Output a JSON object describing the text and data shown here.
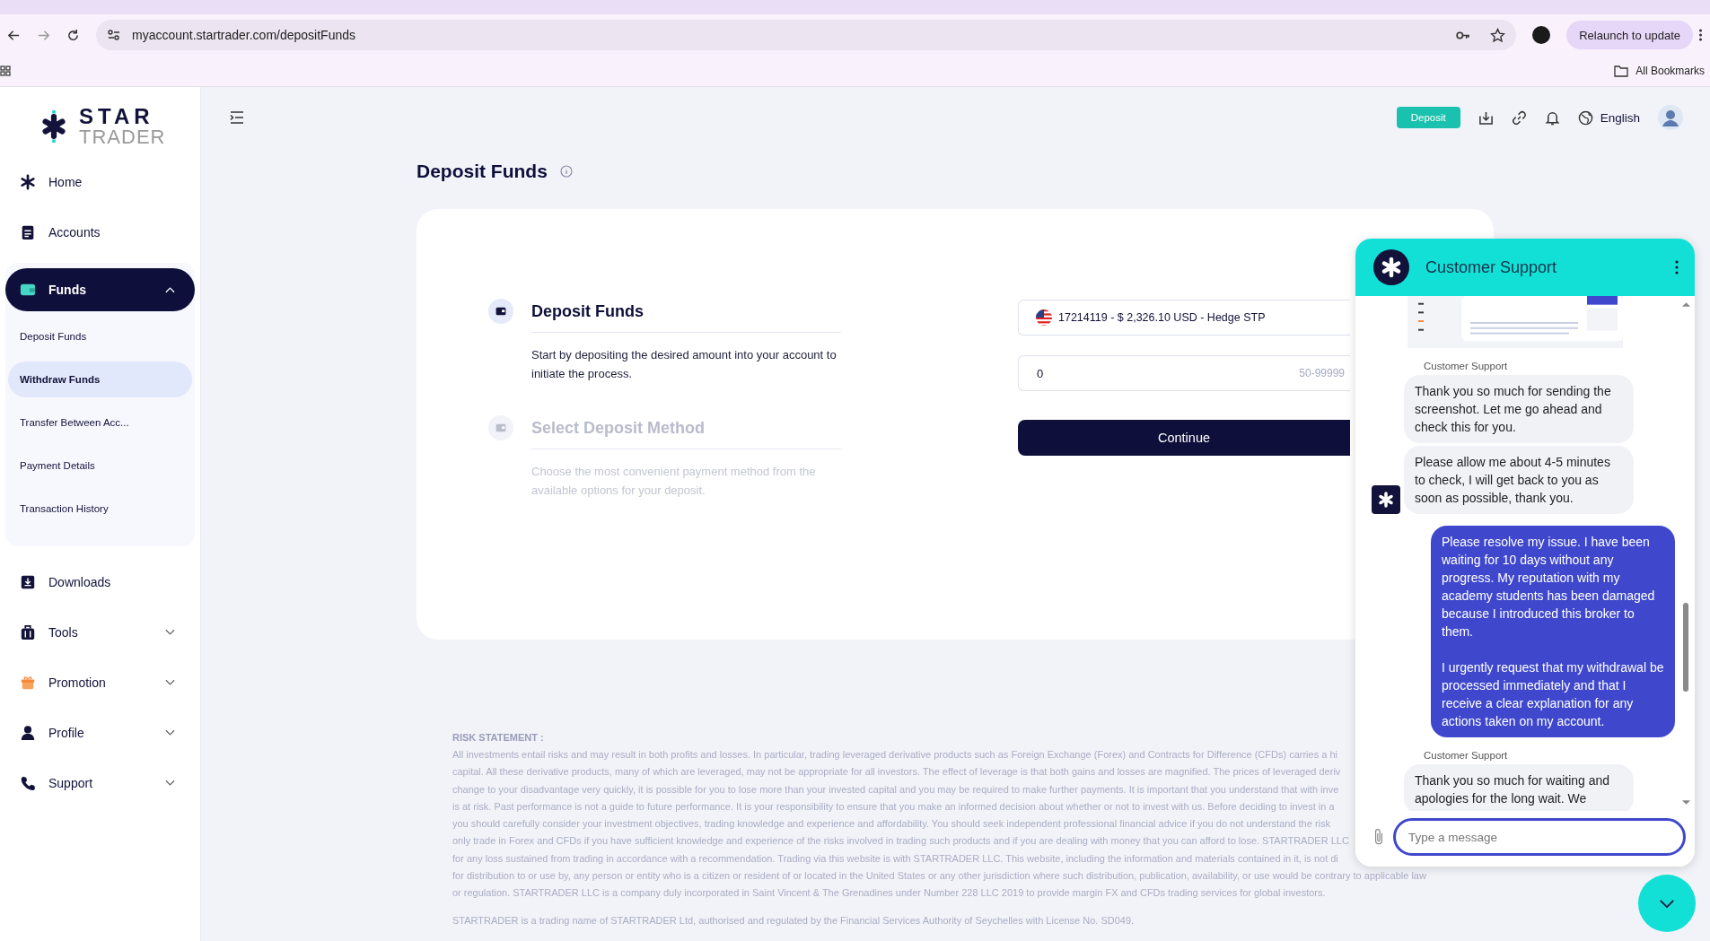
{
  "browser": {
    "url": "myaccount.startrader.com/depositFunds",
    "relaunch": "Relaunch to update",
    "bookmarks": "All Bookmarks"
  },
  "brand": {
    "line1": "STAR",
    "line2": "TRADER"
  },
  "sidebar": {
    "items": [
      {
        "label": "Home",
        "kind": "link",
        "selected": false
      },
      {
        "label": "Accounts",
        "kind": "link",
        "selected": false
      },
      {
        "label": "Funds",
        "kind": "group",
        "selected": true,
        "expanded": true,
        "children": [
          {
            "label": "Deposit Funds",
            "selected": false
          },
          {
            "label": "Withdraw Funds",
            "selected": true
          },
          {
            "label": "Transfer Between Acc...",
            "selected": false
          },
          {
            "label": "Payment Details",
            "selected": false
          },
          {
            "label": "Transaction History",
            "selected": false
          }
        ]
      },
      {
        "label": "Downloads",
        "kind": "link",
        "selected": false
      },
      {
        "label": "Tools",
        "kind": "group",
        "selected": false,
        "expanded": false
      },
      {
        "label": "Promotion",
        "kind": "group",
        "selected": false,
        "expanded": false
      },
      {
        "label": "Profile",
        "kind": "group",
        "selected": false,
        "expanded": false
      },
      {
        "label": "Support",
        "kind": "group",
        "selected": false,
        "expanded": false
      }
    ]
  },
  "header": {
    "deposit_button": "Deposit",
    "language": "English"
  },
  "page": {
    "title": "Deposit Funds"
  },
  "steps": [
    {
      "title": "Deposit Funds",
      "description": "Start by depositing the desired amount into your account to initiate the process.",
      "active": true
    },
    {
      "title": "Select Deposit Method",
      "description": "Choose the most convenient payment method from the available options for your deposit.",
      "active": false
    }
  ],
  "form": {
    "account": "17214119 - $ 2,326.10 USD - Hedge STP",
    "amount": "0",
    "range_hint": "50-99999",
    "button": "Continue"
  },
  "chat": {
    "title": "Customer Support",
    "placeholder": "Type a message",
    "messages": [
      {
        "kind": "picture"
      },
      {
        "kind": "sender",
        "text": "Customer Support"
      },
      {
        "kind": "agent",
        "text": "Thank you so much for sending the screenshot. Let me go ahead and check this for you.",
        "avatar": false
      },
      {
        "kind": "agent",
        "text": "Please allow me about 4-5 minutes to check, I will get back to you as soon as possible, thank you.",
        "avatar": true
      },
      {
        "kind": "user",
        "paragraphs": [
          "Please resolve my issue. I have been waiting for 10 days without any progress. My reputation with my academy students has been damaged because I introduced this broker to them.",
          "I urgently request that my withdrawal be processed immediately and that I receive a clear explanation for any actions taken on my account."
        ]
      },
      {
        "kind": "sender",
        "text": "Customer Support"
      },
      {
        "kind": "agent",
        "text": "Thank you so much for waiting and apologies for the long wait. We",
        "avatar": false
      }
    ]
  },
  "risk": {
    "heading": "RISK STATEMENT :",
    "lines": [
      "All investments entail risks and may result in both profits and losses. In particular, trading leveraged derivative products such as Foreign Exchange (Forex) and Contracts for Difference (CFDs) carries a hi",
      "capital. All these derivative products, many of which are leveraged, may not be appropriate for all investors. The effect of leverage is that both gains and losses are magnified. The prices of leveraged deriv",
      "change to your disadvantage very quickly, it is possible for you to lose more than your invested capital and you may be required to make further payments. It is important that you understand that with inve",
      "is at risk. Past performance is not a guide to future performance. It is your responsibility to ensure that you make an informed decision about whether or not to invest with us. Before deciding to invest in a",
      "you should carefully consider your investment objectives, trading knowledge and experience and affordability. You should seek independent professional financial advice if you do not understand the risk",
      "only trade in Forex and CFDs if you have sufficient knowledge and experience of the risks involved in trading such products and if you are dealing with money that you can afford to lose. STARTRADER LLC",
      "for any loss sustained from trading in accordance with a recommendation. Trading via this website is with STARTRADER LLC. This website, including the information and materials contained in it, is not di",
      "for distribution to or use by, any person or entity who is a citizen or resident of or located in the United States or any other jurisdiction where such distribution, publication, availability, or use would be contrary to applicable law",
      "or regulation. STARTRADER LLC is a company duly incorporated in Saint Vincent & The Grenadines under Number 228 LLC 2019 to provide margin FX and CFDs trading services for global investors."
    ],
    "footer": "STARTRADER is a trading name of STARTRADER Ltd, authorised and regulated by the Financial Services Authority of Seychelles with License No. SD049."
  }
}
